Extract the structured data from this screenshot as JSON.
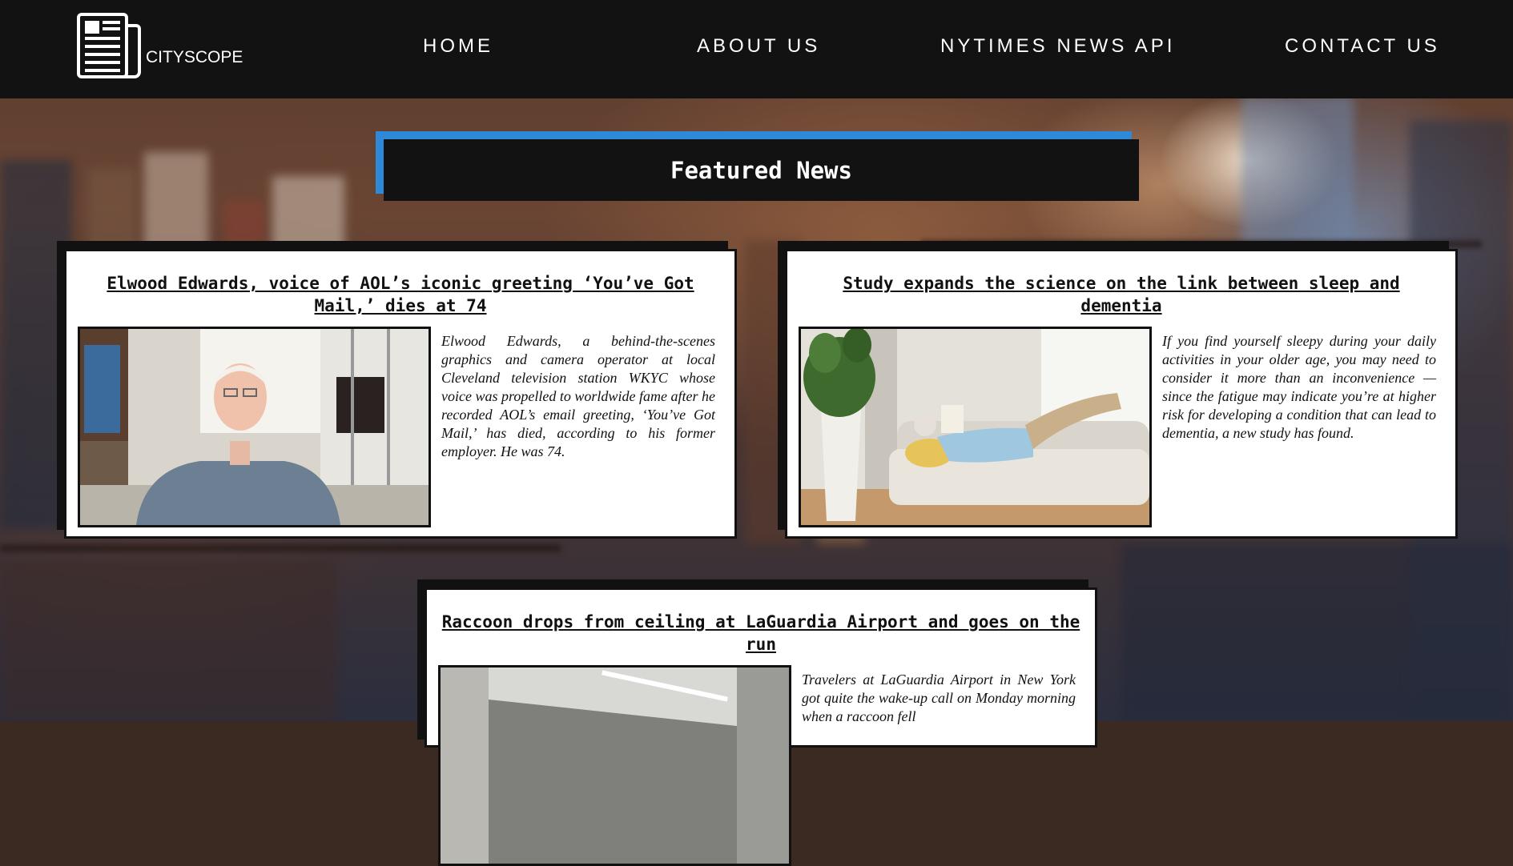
{
  "brand": {
    "name": "CITYSCOPE",
    "icon": "newspaper-icon"
  },
  "nav": {
    "home": "HOME",
    "about": "ABOUT US",
    "api": "NYTIMES NEWS API",
    "contact": "CONTACT US"
  },
  "featured": {
    "title": "Featured News"
  },
  "colors": {
    "header": "#121212",
    "accent": "#2e8ad8",
    "card": "#ffffff"
  },
  "articles": [
    {
      "title": "Elwood Edwards, voice of AOL’s iconic greeting ‘You’ve Got Mail,’ dies at 74",
      "summary": "Elwood Edwards, a behind-the-scenes graphics and camera operator at local Cleveland television station WKYC whose voice was propelled to worldwide fame after he recorded AOL’s email greeting, ‘You’ve Got Mail,’ has died, according to his former employer. He was 74.",
      "image": "elderly man in studio photo"
    },
    {
      "title": "Study expands the science on the link between sleep and dementia",
      "summary": "If you find yourself sleepy during your daily activities in your older age, you may need to consider it more than an inconvenience — since the fatigue may indicate you’re at higher risk for developing a condition that can lead to dementia, a new study has found.",
      "image": "man sleeping on sofa photo"
    },
    {
      "title": "Raccoon drops from ceiling at LaGuardia Airport and goes on the run",
      "summary": "Travelers at LaGuardia Airport in New York got quite the wake-up call on Monday morning when a raccoon fell",
      "image": "airport ceiling photo"
    }
  ]
}
